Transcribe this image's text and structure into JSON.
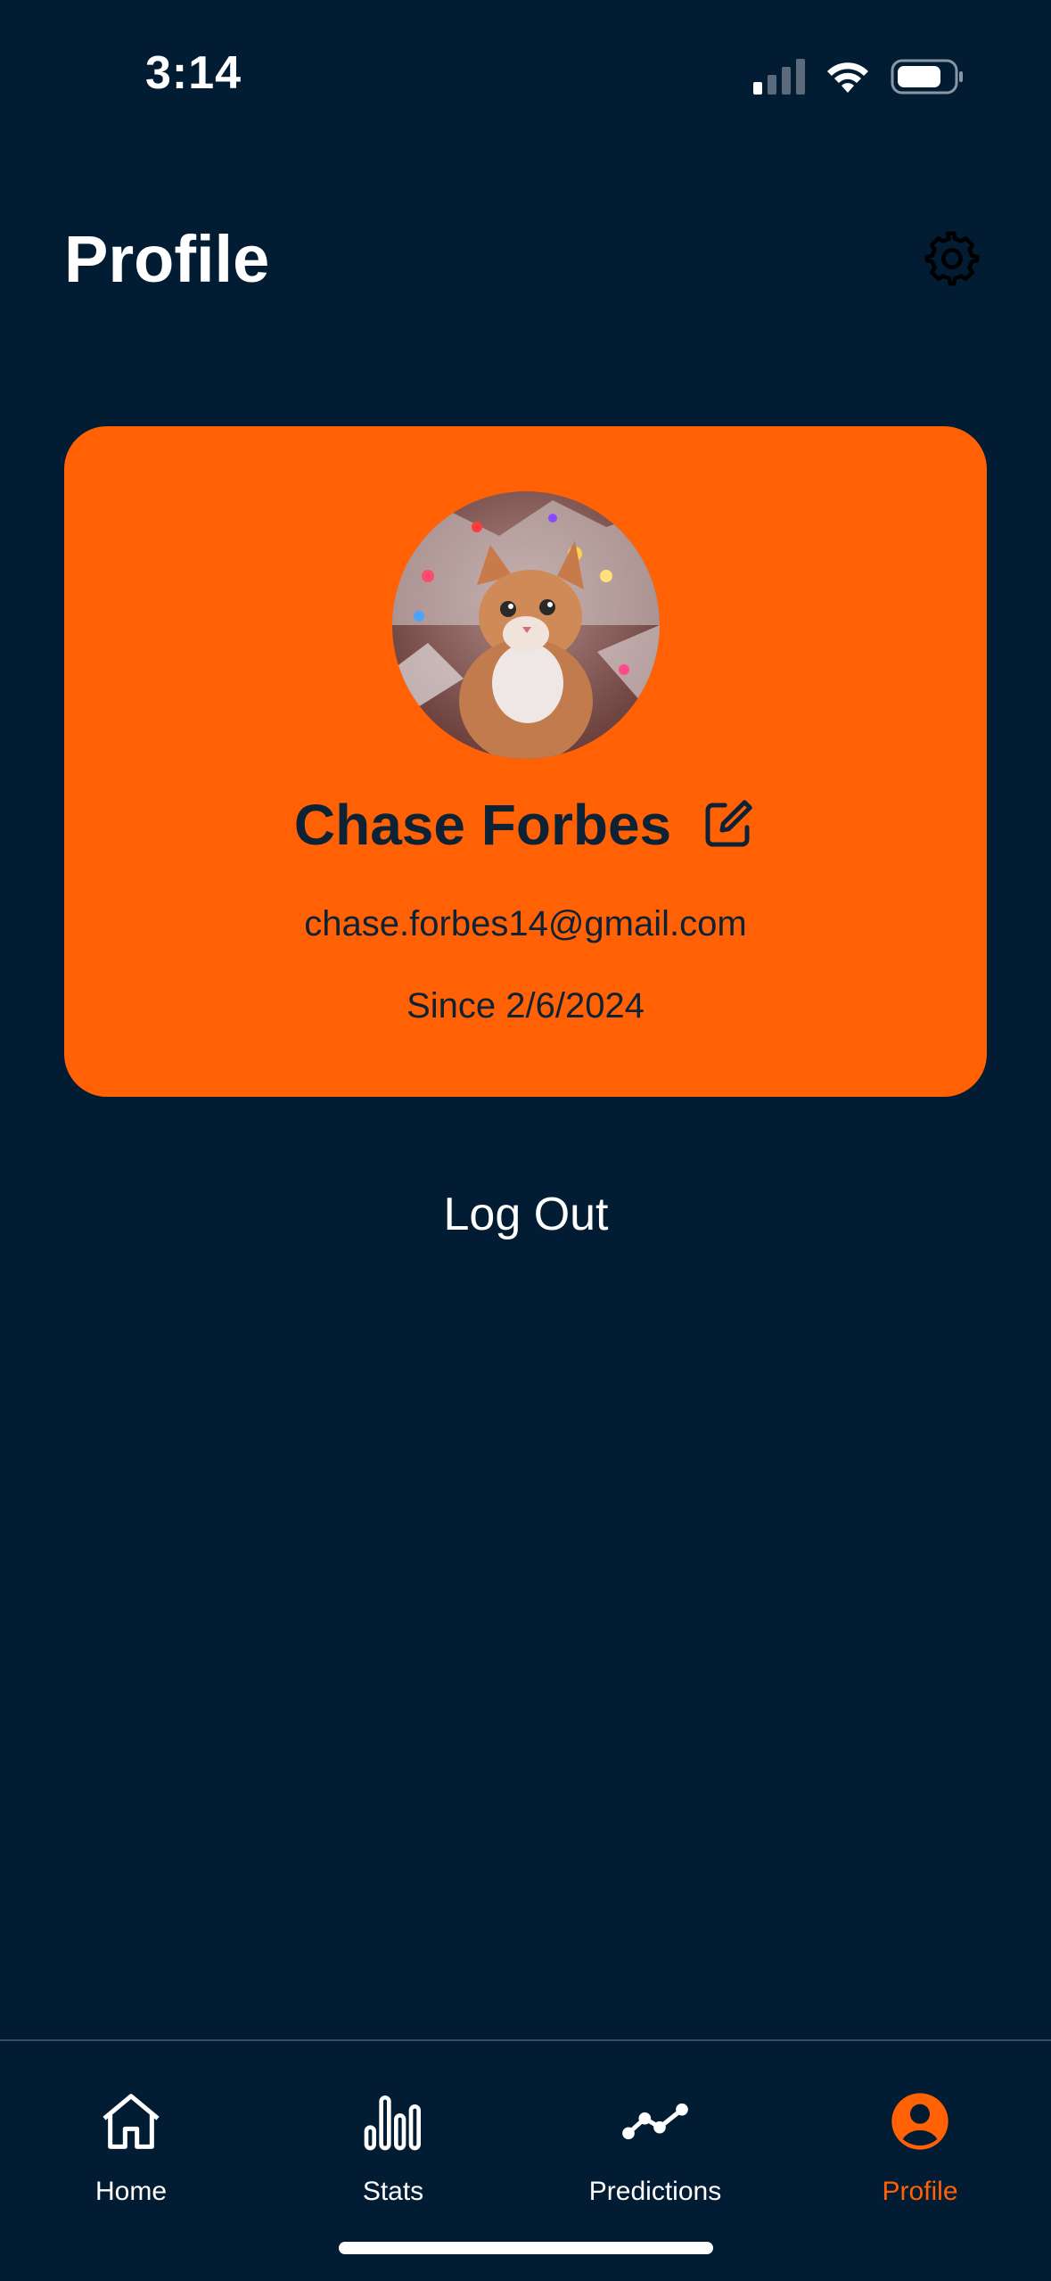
{
  "status_bar": {
    "time": "3:14",
    "icons": [
      "cellular-signal-icon",
      "wifi-icon",
      "battery-icon"
    ]
  },
  "header": {
    "title": "Profile",
    "settings_icon": "gear-icon"
  },
  "profile": {
    "name": "Chase Forbes",
    "email": "chase.forbes14@gmail.com",
    "since": "Since 2/6/2024",
    "avatar_desc": "avatar-photo",
    "edit_icon": "edit-icon"
  },
  "actions": {
    "logout_label": "Log Out"
  },
  "tab_bar": {
    "tabs": [
      {
        "label": "Home",
        "icon": "home-icon",
        "active": false
      },
      {
        "label": "Stats",
        "icon": "bar-chart-icon",
        "active": false
      },
      {
        "label": "Predictions",
        "icon": "trend-line-icon",
        "active": false
      },
      {
        "label": "Profile",
        "icon": "person-icon",
        "active": true
      }
    ]
  },
  "colors": {
    "background": "#021d33",
    "accent": "#ff6104",
    "card_text": "#0e2236",
    "text": "#ffffff"
  }
}
